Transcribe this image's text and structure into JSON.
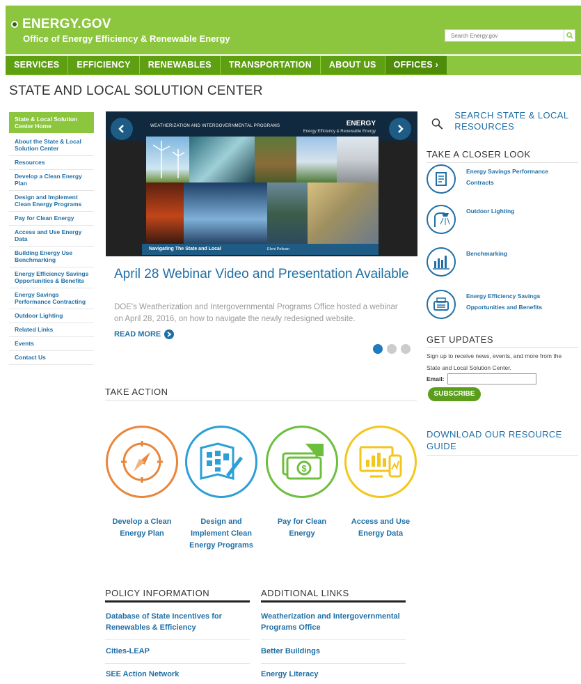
{
  "header": {
    "logo": "ENERGY.GOV",
    "office": "Office of Energy Efficiency & Renewable Energy",
    "search_placeholder": "Search Energy.gov"
  },
  "nav": [
    "SERVICES",
    "EFFICIENCY",
    "RENEWABLES",
    "TRANSPORTATION",
    "ABOUT US",
    "OFFICES"
  ],
  "nav_offices_suffix": "›",
  "page_title": "STATE AND LOCAL SOLUTION CENTER",
  "sidebar": [
    "State & Local Solution Center Home",
    "About the State & Local Solution Center",
    "Resources",
    "Develop a Clean Energy Plan",
    "Design and Implement Clean Energy Programs",
    "Pay for Clean Energy",
    "Access and Use Energy Data",
    "Building Energy Use Benchmarking",
    "Energy Efficiency Savings Opportunities & Benefits",
    "Energy Savings Performance Contracting",
    "Outdoor Lighting",
    "Related Links",
    "Events",
    "Contact Us"
  ],
  "carousel": {
    "program": "WEATHERIZATION AND INTERGOVERNMENTAL PROGRAMS",
    "doe": "ENERGY",
    "eere": "Energy Efficiency & Renewable Energy",
    "caption": "Navigating The State and Local",
    "caption_credit": "Eleni Pelican"
  },
  "feature": {
    "headline": "April 28 Webinar Video and Presentation Available",
    "description": "DOE's Weatherization and Intergovernmental Programs Office hosted a webinar on April 28, 2016, on how to navigate the newly redesigned website.",
    "read_more": "READ MORE"
  },
  "take_action": {
    "heading": "TAKE ACTION",
    "items": [
      {
        "label": "Develop a Clean Energy Plan",
        "color": "#e9863a"
      },
      {
        "label": "Design and Implement Clean Energy Programs",
        "color": "#2b9fd6"
      },
      {
        "label": "Pay for Clean Energy",
        "color": "#6cbf3c"
      },
      {
        "label": "Access and Use Energy Data",
        "color": "#f3c61c"
      }
    ]
  },
  "policy": {
    "heading": "POLICY INFORMATION",
    "links": [
      "Database of State Incentives for Renewables & Efficiency",
      "Cities-LEAP",
      "SEE Action Network"
    ]
  },
  "additional": {
    "heading": "ADDITIONAL LINKS",
    "links": [
      "Weatherization and Intergovernmental Programs Office",
      "Better Buildings",
      "Energy Literacy"
    ]
  },
  "right": {
    "search_title": "SEARCH STATE & LOCAL RESOURCES",
    "closer_heading": "TAKE A CLOSER LOOK",
    "closer_items": [
      "Energy Savings Performance Contracts",
      "Outdoor Lighting",
      "Benchmarking",
      "Energy Efficiency Savings Opportunities and Benefits"
    ],
    "updates_heading": "GET UPDATES",
    "updates_text": "Sign up to receive news, events, and more from the State and Local Solution Center.",
    "email_label": "Email:",
    "subscribe": "SUBSCRIBE",
    "download": "DOWNLOAD OUR RESOURCE GUIDE"
  }
}
